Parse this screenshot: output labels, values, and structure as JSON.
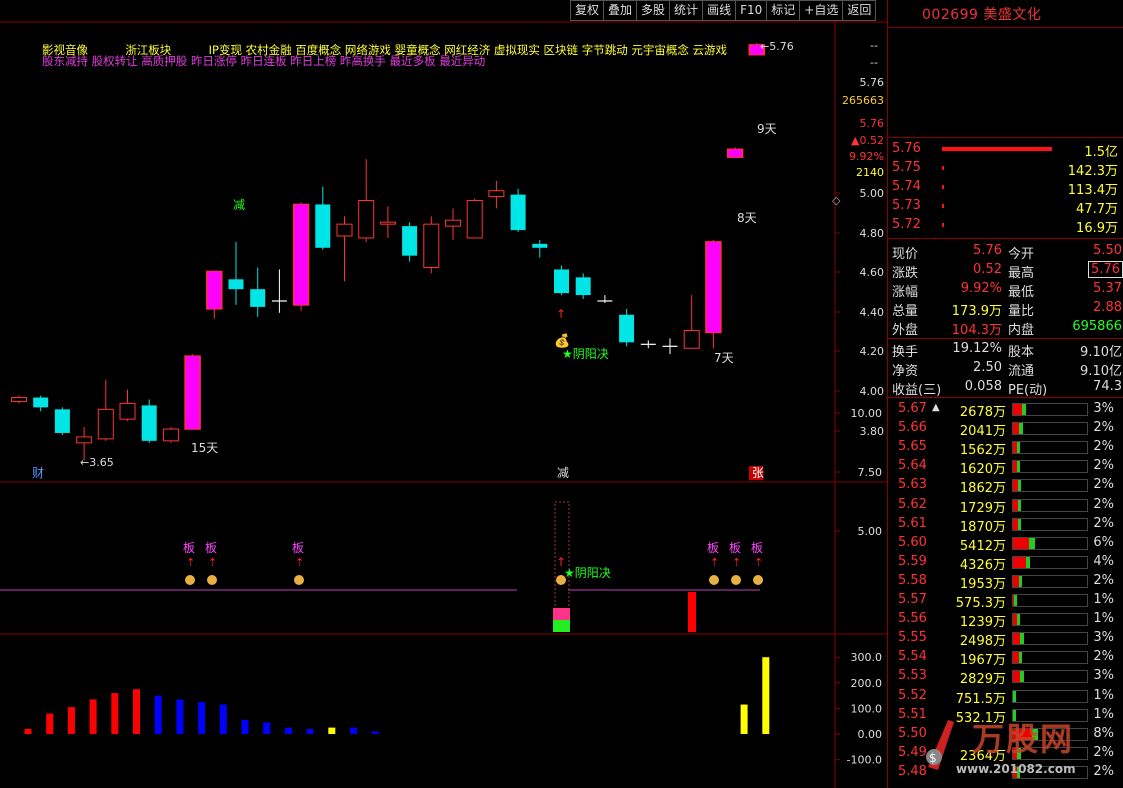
{
  "toolbar": [
    "复权",
    "叠加",
    "多股",
    "统计",
    "画线",
    "F10",
    "标记",
    "+自选",
    "返回"
  ],
  "stock": {
    "code": "002699",
    "name": "美盛文化"
  },
  "concepts": {
    "line1": [
      {
        "text": "影视音像",
        "color": "#ffff33"
      },
      {
        "text": "浙江板块",
        "color": "#ffff33"
      },
      {
        "text": "IP变现 农村金融 百度概念 网络游戏 婴童概念 网红经济 虚拟现实 区块链 字节跳动 元宇宙概念 云游戏",
        "color": "#ffff33"
      }
    ],
    "line2": "股东减持 股权转让 高质押股 昨日涨停 昨日连板 昨日上榜 昨高换手 最近多板 最近异动"
  },
  "main_axis": {
    "labels": [
      "5.76",
      "265663",
      "5.76",
      "0.52",
      "9.92%",
      "2140",
      "5.00",
      "4.80",
      "4.60",
      "4.40",
      "4.20",
      "4.00",
      "3.80"
    ],
    "top_dashes": [
      "--",
      "--"
    ],
    "up_arrow": "▲"
  },
  "chart_data": {
    "type": "candlestick",
    "candles": [
      {
        "o": 3.95,
        "c": 3.97,
        "h": 3.98,
        "l": 3.94
      },
      {
        "o": 3.97,
        "c": 3.92,
        "h": 3.98,
        "l": 3.9
      },
      {
        "o": 3.91,
        "c": 3.79,
        "h": 3.92,
        "l": 3.78
      },
      {
        "o": 3.74,
        "c": 3.77,
        "h": 3.82,
        "l": 3.65
      },
      {
        "o": 3.76,
        "c": 3.91,
        "h": 4.06,
        "l": 3.75
      },
      {
        "o": 3.86,
        "c": 3.94,
        "h": 4.01,
        "l": 3.85
      },
      {
        "o": 3.93,
        "c": 3.75,
        "h": 3.96,
        "l": 3.74
      },
      {
        "o": 3.75,
        "c": 3.81,
        "h": 3.82,
        "l": 3.74
      },
      {
        "o": 3.81,
        "c": 4.18,
        "h": 4.19,
        "l": 3.81
      },
      {
        "o": 4.42,
        "c": 4.61,
        "h": 4.61,
        "l": 4.37
      },
      {
        "o": 4.57,
        "c": 4.52,
        "h": 4.76,
        "l": 4.44
      },
      {
        "o": 4.52,
        "c": 4.43,
        "h": 4.63,
        "l": 4.38
      },
      {
        "o": 4.46,
        "c": 4.46,
        "h": 4.62,
        "l": 4.4
      },
      {
        "o": 4.44,
        "c": 4.95,
        "h": 4.96,
        "l": 4.41
      },
      {
        "o": 4.95,
        "c": 4.73,
        "h": 5.04,
        "l": 4.72
      },
      {
        "o": 4.79,
        "c": 4.85,
        "h": 4.89,
        "l": 4.56
      },
      {
        "o": 4.78,
        "c": 4.97,
        "h": 5.18,
        "l": 4.76
      },
      {
        "o": 4.85,
        "c": 4.86,
        "h": 4.94,
        "l": 4.78
      },
      {
        "o": 4.84,
        "c": 4.69,
        "h": 4.86,
        "l": 4.66
      },
      {
        "o": 4.63,
        "c": 4.85,
        "h": 4.89,
        "l": 4.6
      },
      {
        "o": 4.84,
        "c": 4.87,
        "h": 4.93,
        "l": 4.77
      },
      {
        "o": 4.78,
        "c": 4.97,
        "h": 4.98,
        "l": 4.78
      },
      {
        "o": 4.99,
        "c": 5.02,
        "h": 5.07,
        "l": 4.93
      },
      {
        "o": 5.0,
        "c": 4.82,
        "h": 5.03,
        "l": 4.81
      },
      {
        "o": 4.75,
        "c": 4.73,
        "h": 4.77,
        "l": 4.68
      },
      {
        "o": 4.62,
        "c": 4.5,
        "h": 4.64,
        "l": 4.49
      },
      {
        "o": 4.58,
        "c": 4.49,
        "h": 4.6,
        "l": 4.47
      },
      {
        "o": 4.46,
        "c": 4.46,
        "h": 4.49,
        "l": 4.45
      },
      {
        "o": 4.39,
        "c": 4.25,
        "h": 4.42,
        "l": 4.23
      },
      {
        "o": 4.24,
        "c": 4.24,
        "h": 4.26,
        "l": 4.22
      },
      {
        "o": 4.23,
        "c": 4.23,
        "h": 4.27,
        "l": 4.19
      },
      {
        "o": 4.22,
        "c": 4.31,
        "h": 4.49,
        "l": 4.22
      },
      {
        "o": 4.3,
        "c": 4.76,
        "h": 4.77,
        "l": 4.22
      },
      {
        "o": 5.19,
        "c": 5.23,
        "h": 5.24,
        "l": 5.22
      },
      {
        "o": 5.71,
        "c": 5.76,
        "h": 5.77,
        "l": 5.73
      }
    ],
    "limit_up_labels": [
      "15天",
      "8天",
      "9天",
      "7天"
    ],
    "main_annotations": {
      "low": "←3.65",
      "high": "←5.76",
      "jian": "减",
      "yinyang": "★阴阳决"
    },
    "bottom_markers": [
      "财",
      "减",
      "张"
    ],
    "middle_axis": [
      "10.00",
      "7.50",
      "5.00"
    ],
    "middle_marks": [
      "板",
      "板",
      "板",
      "板",
      "板",
      "板"
    ],
    "middle_yinyang": "★阴阳决",
    "lower_axis": [
      "300.0",
      "200.0",
      "100.0",
      "0.00",
      "-100.0"
    ],
    "bars": [
      {
        "v": 20,
        "c": "#ff0000"
      },
      {
        "v": 80,
        "c": "#ff0000"
      },
      {
        "v": 105,
        "c": "#ff0000"
      },
      {
        "v": 135,
        "c": "#ff0000"
      },
      {
        "v": 160,
        "c": "#ff0000"
      },
      {
        "v": 175,
        "c": "#ff0000"
      },
      {
        "v": 150,
        "c": "#0000ff"
      },
      {
        "v": 135,
        "c": "#0000ff"
      },
      {
        "v": 125,
        "c": "#0000ff"
      },
      {
        "v": 115,
        "c": "#0000ff"
      },
      {
        "v": 55,
        "c": "#0000ff"
      },
      {
        "v": 45,
        "c": "#0000ff"
      },
      {
        "v": 25,
        "c": "#0000ff"
      },
      {
        "v": 20,
        "c": "#0000ff"
      },
      {
        "v": 25,
        "c": "#ffff00"
      },
      {
        "v": 25,
        "c": "#0000ff"
      },
      {
        "v": 10,
        "c": "#0000ff"
      },
      {
        "v": 0,
        "c": "#000000"
      },
      {
        "v": 0,
        "c": "#000000"
      },
      {
        "v": 0,
        "c": "#000000"
      },
      {
        "v": 0,
        "c": "#000000"
      },
      {
        "v": 0,
        "c": "#000000"
      },
      {
        "v": 0,
        "c": "#000000"
      },
      {
        "v": 0,
        "c": "#000000"
      },
      {
        "v": 0,
        "c": "#000000"
      },
      {
        "v": 0,
        "c": "#000000"
      },
      {
        "v": 0,
        "c": "#000000"
      },
      {
        "v": 0,
        "c": "#000000"
      },
      {
        "v": 0,
        "c": "#000000"
      },
      {
        "v": 0,
        "c": "#000000"
      },
      {
        "v": 0,
        "c": "#000000"
      },
      {
        "v": 0,
        "c": "#000000"
      },
      {
        "v": 0,
        "c": "#000000"
      },
      {
        "v": 115,
        "c": "#ffff00"
      },
      {
        "v": 300,
        "c": "#ffff00"
      }
    ]
  },
  "orderbook": [
    {
      "price": "5.76",
      "vol": "1.5亿"
    },
    {
      "price": "5.75",
      "vol": "142.3万"
    },
    {
      "price": "5.74",
      "vol": "113.4万"
    },
    {
      "price": "5.73",
      "vol": "47.7万"
    },
    {
      "price": "5.72",
      "vol": "16.9万"
    }
  ],
  "quote_rows": [
    {
      "l1": "现价",
      "v1": "5.76",
      "c1": "red",
      "l2": "今开",
      "v2": "5.50",
      "c2": "red"
    },
    {
      "l1": "涨跌",
      "v1": "0.52",
      "c1": "red",
      "l2": "最高",
      "v2": "5.76",
      "c2": "red"
    },
    {
      "l1": "涨幅",
      "v1": "9.92%",
      "c1": "red",
      "l2": "最低",
      "v2": "5.37",
      "c2": "red"
    },
    {
      "l1": "总量",
      "v1": "173.9万",
      "c1": "yel",
      "l2": "量比",
      "v2": "2.88",
      "c2": "red"
    },
    {
      "l1": "外盘",
      "v1": "104.3万",
      "c1": "red",
      "l2": "内盘",
      "v2": "695866",
      "c2": "grn"
    }
  ],
  "quote_rows2": [
    {
      "l1": "换手",
      "v1": "19.12%",
      "l2": "股本",
      "v2": "9.10亿"
    },
    {
      "l1": "净资",
      "v1": "2.50",
      "l2": "流通",
      "v2": "9.10亿"
    },
    {
      "l1": "收益(三)",
      "v1": "0.058",
      "l2": "PE(动)",
      "v2": "74.3"
    }
  ],
  "price_levels": [
    {
      "p": "5.67",
      "v": "2678万",
      "pct": "3%",
      "r": 0.12,
      "g": 0.05
    },
    {
      "p": "5.66",
      "v": "2041万",
      "pct": "2%",
      "r": 0.08,
      "g": 0.05
    },
    {
      "p": "5.65",
      "v": "1562万",
      "pct": "2%",
      "r": 0.06,
      "g": 0.04
    },
    {
      "p": "5.64",
      "v": "1620万",
      "pct": "2%",
      "r": 0.06,
      "g": 0.04
    },
    {
      "p": "5.63",
      "v": "1862万",
      "pct": "2%",
      "r": 0.07,
      "g": 0.04
    },
    {
      "p": "5.62",
      "v": "1729万",
      "pct": "2%",
      "r": 0.07,
      "g": 0.04
    },
    {
      "p": "5.61",
      "v": "1870万",
      "pct": "2%",
      "r": 0.07,
      "g": 0.04
    },
    {
      "p": "5.60",
      "v": "5412万",
      "pct": "6%",
      "r": 0.22,
      "g": 0.08
    },
    {
      "p": "5.59",
      "v": "4326万",
      "pct": "4%",
      "r": 0.18,
      "g": 0.06
    },
    {
      "p": "5.58",
      "v": "1953万",
      "pct": "2%",
      "r": 0.08,
      "g": 0.04
    },
    {
      "p": "5.57",
      "v": "575.3万",
      "pct": "1%",
      "r": 0.02,
      "g": 0.02
    },
    {
      "p": "5.56",
      "v": "1239万",
      "pct": "1%",
      "r": 0.05,
      "g": 0.03
    },
    {
      "p": "5.55",
      "v": "2498万",
      "pct": "3%",
      "r": 0.1,
      "g": 0.05
    },
    {
      "p": "5.54",
      "v": "1967万",
      "pct": "2%",
      "r": 0.08,
      "g": 0.04
    },
    {
      "p": "5.53",
      "v": "2829万",
      "pct": "3%",
      "r": 0.1,
      "g": 0.05
    },
    {
      "p": "5.52",
      "v": "751.5万",
      "pct": "1%",
      "r": 0.0,
      "g": 0.04
    },
    {
      "p": "5.51",
      "v": "532.1万",
      "pct": "1%",
      "r": 0.0,
      "g": 0.03
    },
    {
      "p": "5.50",
      "v": "",
      "pct": "8%",
      "r": 0.25,
      "g": 0.08
    },
    {
      "p": "5.49",
      "v": "2364万",
      "pct": "2%",
      "r": 0.05,
      "g": 0.05
    },
    {
      "p": "5.48",
      "v": "",
      "pct": "2%",
      "r": 0.05,
      "g": 0.04
    }
  ],
  "watermark": {
    "brand": "万股网",
    "url": "www.201082.com"
  }
}
